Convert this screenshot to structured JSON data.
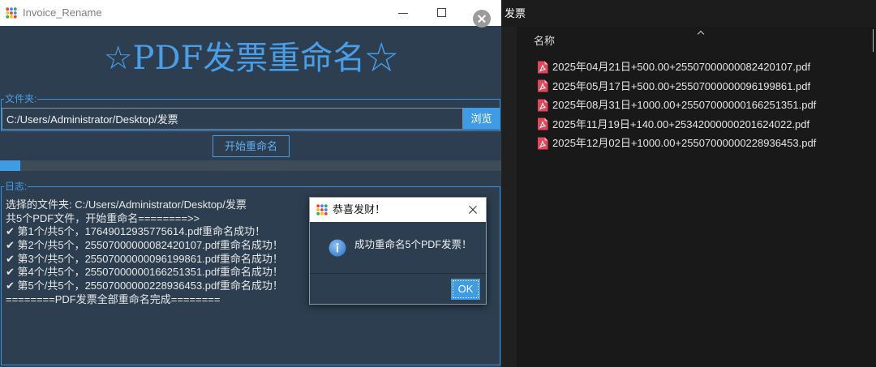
{
  "app": {
    "window_title": "Invoice_Rename",
    "heading": "☆PDF发票重命名☆",
    "folder_group_label": "文件夹:",
    "folder_path": "C:/Users/Administrator/Desktop/发票",
    "browse_label": "浏览",
    "start_label": "开始重命名",
    "progress_percent": 4,
    "log_group_label": "日志:",
    "log_lines": [
      "选择的文件夹: C:/Users/Administrator/Desktop/发票",
      "共5个PDF文件，开始重命名========>>",
      "✔ 第1个/共5个，17649012935775614.pdf重命名成功！",
      "✔ 第2个/共5个，25507000000082420107.pdf重命名成功！",
      "✔ 第3个/共5个，25507000000096199861.pdf重命名成功！",
      "✔ 第4个/共5个，25507000000166251351.pdf重命名成功！",
      "✔ 第5个/共5个，25507000000228936453.pdf重命名成功！",
      "========PDF发票全部重命名完成========"
    ]
  },
  "dialog": {
    "title": "恭喜发财！",
    "message": "成功重命名5个PDF发票！",
    "ok_label": "OK"
  },
  "explorer": {
    "folder_name": "发票",
    "column_name": "名称",
    "files": [
      {
        "name": "2025年04月21日+500.00+25507000000082420107.pdf"
      },
      {
        "name": "2025年05月17日+500.00+25507000000096199861.pdf"
      },
      {
        "name": "2025年08月31日+1000.00+25507000000166251351.pdf"
      },
      {
        "name": "2025年11月19日+140.00+25342000000201624022.pdf"
      },
      {
        "name": "2025年12月02日+1000.00+25507000000228936453.pdf"
      }
    ]
  },
  "icons": {
    "app": "app-grid-icon",
    "window_controls": [
      "minimize-icon",
      "maximize-icon",
      "close-icon"
    ],
    "dialog_info": "info-icon",
    "file": "pdf-file-icon",
    "sort": "sort-ascending-icon"
  },
  "colors": {
    "app_background": "#2c3e50",
    "accent": "#3f9be6",
    "heading": "#4a9ee8",
    "group_border": "#3a8fd9",
    "progress_track": "#3e4c58",
    "log_text": "#e8e8e8",
    "explorer_background": "#191919",
    "pdf_icon": "#e0475b"
  }
}
